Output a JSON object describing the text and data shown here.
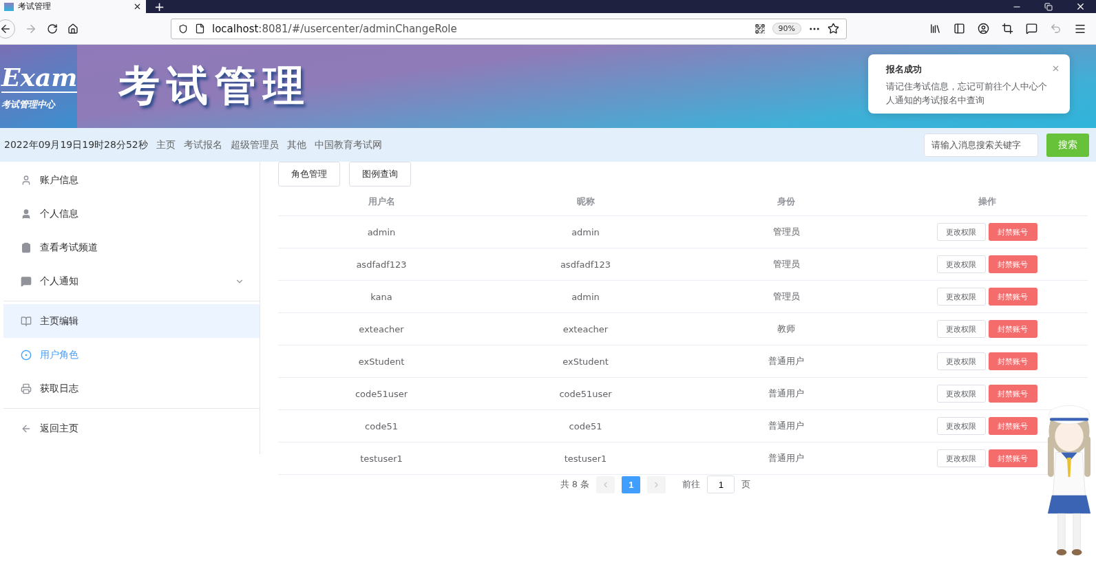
{
  "browser": {
    "tab_title": "考试管理",
    "new_tab": "+",
    "url": "**localhost**:8081/#/usercenter/adminChangeRole",
    "zoom": "90%"
  },
  "header": {
    "logo_text": "Exam",
    "logo_subtitle": "考试管理中心",
    "title": "考试管理"
  },
  "notification": {
    "title": "报名成功",
    "message": "请记住考试信息，忘记可前往个人中心个人通知的考试报名中查询"
  },
  "nav": {
    "datetime": "2022年09月19日19时28分52秒",
    "links": [
      "主页",
      "考试报名",
      "超级管理员",
      "其他",
      "中国教育考试网"
    ],
    "search": {
      "placeholder": "请输入消息搜索关键字"
    },
    "search_button": "搜索"
  },
  "sidebar": {
    "groups": [
      {
        "items": [
          {
            "label": "账户信息",
            "selected": false,
            "highlighted": false
          },
          {
            "label": "个人信息",
            "selected": false,
            "highlighted": false
          },
          {
            "label": "查看考试频道",
            "selected": false,
            "highlighted": false
          },
          {
            "label": "个人通知",
            "selected": false,
            "highlighted": false,
            "expanded": false
          }
        ]
      },
      {
        "items": [
          {
            "label": "主页编辑",
            "selected": false,
            "highlighted": true
          },
          {
            "label": "用户角色",
            "selected": true,
            "highlighted": false
          },
          {
            "label": "获取日志",
            "selected": false,
            "highlighted": false
          }
        ]
      },
      {
        "items": [
          {
            "label": "返回主页",
            "selected": false,
            "highlighted": false
          }
        ]
      }
    ]
  },
  "toolbar_buttons": [
    "角色管理",
    "图例查询"
  ],
  "table": {
    "columns": [
      "用户名",
      "昵称",
      "身份",
      "操作"
    ],
    "rows": [
      {
        "username": "admin",
        "nickname": "admin",
        "role": "管理员",
        "actions": [
          "更改权限",
          "封禁账号"
        ]
      },
      {
        "username": "asdfadf123",
        "nickname": "asdfadf123",
        "role": "管理员",
        "actions": [
          "更改权限",
          "封禁账号"
        ]
      },
      {
        "username": "kana",
        "nickname": "admin",
        "role": "管理员",
        "actions": [
          "更改权限",
          "封禁账号"
        ]
      },
      {
        "username": "exteacher",
        "nickname": "exteacher",
        "role": "教师",
        "actions": [
          "更改权限",
          "封禁账号"
        ]
      },
      {
        "username": "exStudent",
        "nickname": "exStudent",
        "role": "普通用户",
        "actions": [
          "更改权限",
          "封禁账号"
        ]
      },
      {
        "username": "code51user",
        "nickname": "code51user",
        "role": "普通用户",
        "actions": [
          "更改权限",
          "封禁账号"
        ]
      },
      {
        "username": "code51",
        "nickname": "code51",
        "role": "普通用户",
        "actions": [
          "更改权限",
          "封禁账号"
        ]
      },
      {
        "username": "testuser1",
        "nickname": "testuser1",
        "role": "普通用户",
        "actions": [
          "更改权限",
          "封禁账号"
        ]
      }
    ]
  },
  "pagination": {
    "total": "共 8 条",
    "pages": [
      {
        "label": "1",
        "selected": true
      }
    ],
    "goto_label": "前往",
    "goto_value": "1",
    "goto_suffix": "页"
  },
  "mascot": {
    "kind": "picture"
  }
}
